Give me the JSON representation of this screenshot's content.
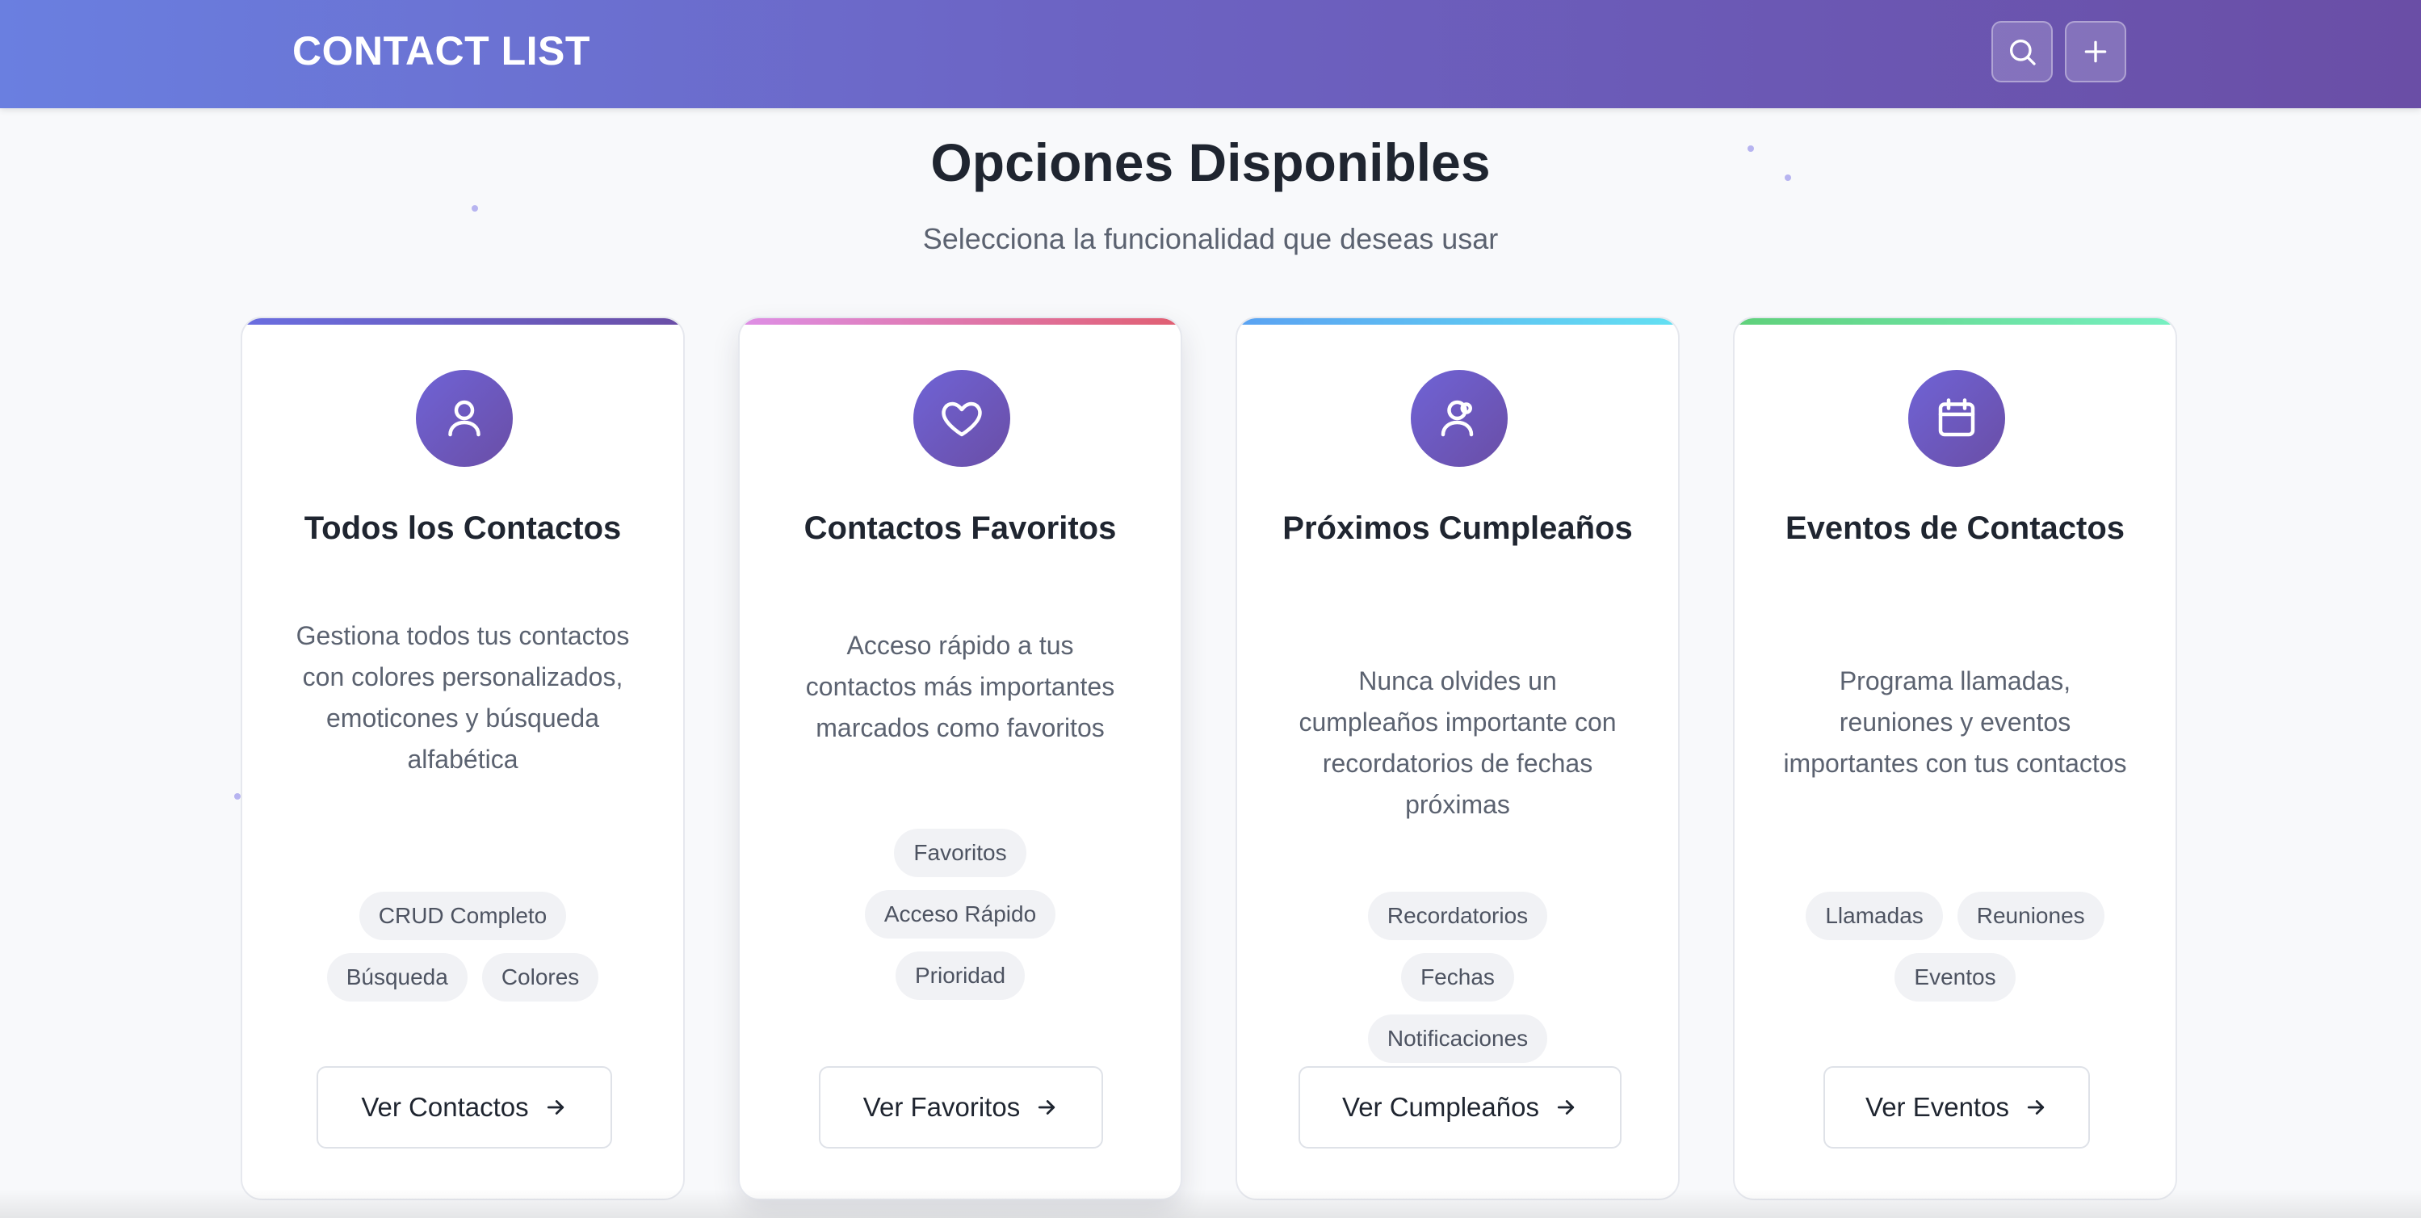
{
  "header": {
    "brand": "CONTACT LIST",
    "search_icon": "search-icon",
    "add_icon": "plus-icon"
  },
  "main": {
    "title": "Opciones Disponibles",
    "subtitle": "Selecciona la funcionalidad que deseas usar"
  },
  "cards": [
    {
      "icon": "user-icon",
      "title": "Todos los Contactos",
      "description": "Gestiona todos tus contactos con colores personalizados, emoticones y búsqueda alfabética",
      "tags": [
        "CRUD Completo",
        "Búsqueda",
        "Colores"
      ],
      "button": "Ver Contactos"
    },
    {
      "icon": "heart-icon",
      "title": "Contactos Favoritos",
      "description": "Acceso rápido a tus contactos más importantes marcados como favoritos",
      "tags": [
        "Favoritos",
        "Acceso Rápido",
        "Prioridad"
      ],
      "button": "Ver Favoritos"
    },
    {
      "icon": "user-birthday-icon",
      "title": "Próximos Cumpleaños",
      "description": "Nunca olvides un cumpleaños importante con recordatorios de fechas próximas",
      "tags": [
        "Recordatorios",
        "Fechas",
        "Notificaciones"
      ],
      "button": "Ver Cumpleaños"
    },
    {
      "icon": "calendar-icon",
      "title": "Eventos de Contactos",
      "description": "Programa llamadas, reuniones y eventos importantes con tus contactos",
      "tags": [
        "Llamadas",
        "Reuniones",
        "Eventos"
      ],
      "button": "Ver Eventos"
    }
  ],
  "colors": {
    "header_start": "#6a7fe0",
    "header_end": "#6a4ea6",
    "icon_circle": "#6f63d6",
    "card1_accent": "#6a6ee0",
    "card2_accent": "#e05f72",
    "card3_accent": "#5aa2f2",
    "card4_accent": "#5fd07a"
  }
}
